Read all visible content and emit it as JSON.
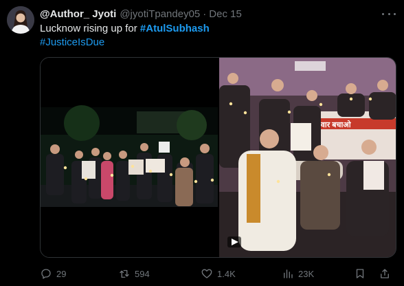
{
  "tweet": {
    "author_name": "@Author_ Jyoti",
    "handle": "@jyotiTpandey05",
    "separator": "·",
    "date": "Dec 15",
    "text_prefix": "Lucknow rising up for ",
    "hashtag1": "#AtulSubhash",
    "hashtag2": "#JusticeIsDue",
    "media_left_sign": "न्याय",
    "media_banner_text": "र-परिवार बचाओ"
  },
  "actions": {
    "replies": "29",
    "retweets": "594",
    "likes": "1.4K",
    "views": "23K"
  },
  "icons": {
    "avatar": "avatar",
    "more": "more-icon",
    "reply": "reply-icon",
    "retweet": "retweet-icon",
    "like": "heart-icon",
    "views": "views-icon",
    "bookmark": "bookmark-icon",
    "share": "share-icon",
    "play": "play-icon"
  },
  "colors": {
    "background": "#000000",
    "text": "#e7e9ea",
    "muted": "#71767b",
    "accent": "#1d9bf0"
  }
}
